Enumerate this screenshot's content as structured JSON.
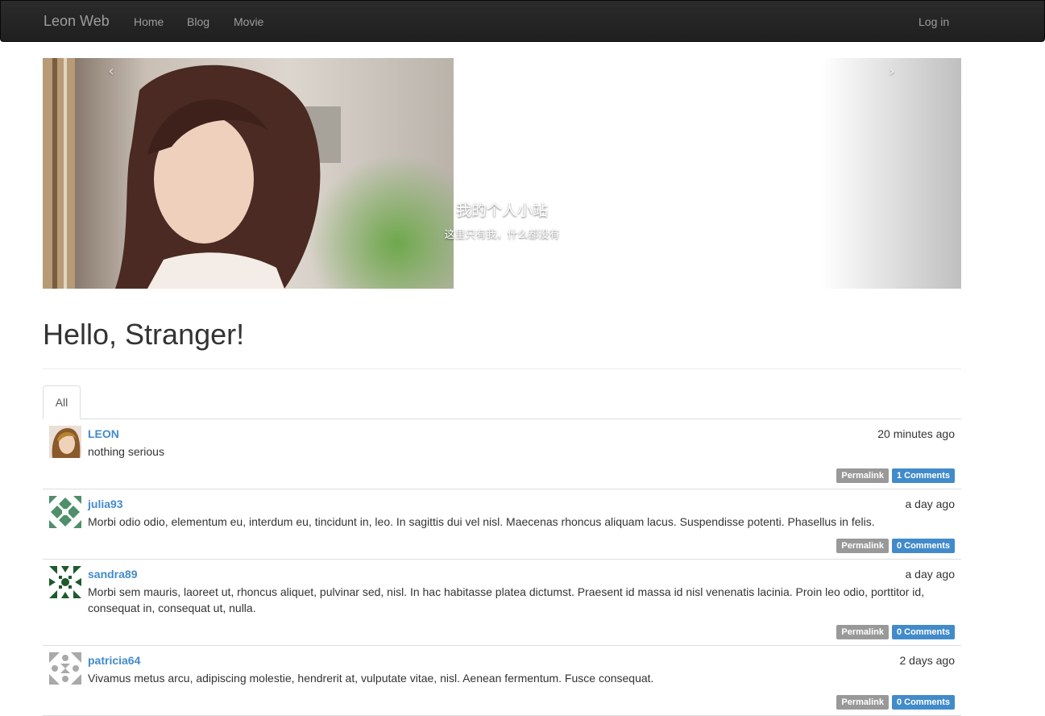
{
  "navbar": {
    "brand": "Leon Web",
    "links": [
      "Home",
      "Blog",
      "Movie"
    ],
    "login": "Log in"
  },
  "carousel": {
    "prev_glyph": "‹",
    "next_glyph": "›",
    "title": "我的个人小站",
    "subtitle": "这里只有我，什么都没有"
  },
  "page": {
    "title": "Hello, Stranger!",
    "tab_all": "All"
  },
  "posts": [
    {
      "author": "LEON",
      "date": "20 minutes ago",
      "body": "nothing serious",
      "permalink": "Permalink",
      "comments": "1 Comments"
    },
    {
      "author": "julia93",
      "date": "a day ago",
      "body": "Morbi odio odio, elementum eu, interdum eu, tincidunt in, leo. In sagittis dui vel nisl. Maecenas rhoncus aliquam lacus. Suspendisse potenti. Phasellus in felis.",
      "permalink": "Permalink",
      "comments": "0 Comments"
    },
    {
      "author": "sandra89",
      "date": "a day ago",
      "body": "Morbi sem mauris, laoreet ut, rhoncus aliquet, pulvinar sed, nisl. In hac habitasse platea dictumst. Praesent id massa id nisl venenatis lacinia. Proin leo odio, porttitor id, consequat in, consequat ut, nulla.",
      "permalink": "Permalink",
      "comments": "0 Comments"
    },
    {
      "author": "patricia64",
      "date": "2 days ago",
      "body": "Vivamus metus arcu, adipiscing molestie, hendrerit at, vulputate vitae, nisl. Aenean fermentum. Fusce consequat.",
      "permalink": "Permalink",
      "comments": "0 Comments"
    }
  ],
  "colors": {
    "navbar_bg": "#222222",
    "link_blue": "#428bca",
    "permalink_gray": "#999999",
    "avatar_julia": "#4f8f6b",
    "avatar_sandra": "#1e5a2c",
    "avatar_patricia": "#a9a9a9"
  }
}
